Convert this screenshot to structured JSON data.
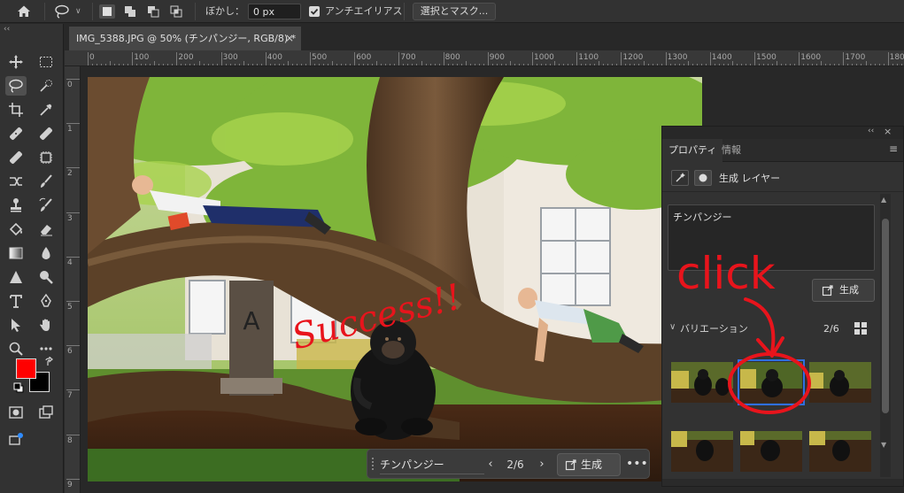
{
  "options_bar": {
    "feather_label": "ぼかし：",
    "feather_value": "0 px",
    "antialias_label": "アンチエイリアス",
    "antialias_checked": true,
    "select_mask_label": "選択とマスク..."
  },
  "toolbar": {
    "collapse_glyph": "‹‹",
    "foreground_color": "#ff0000",
    "background_color": "#000000"
  },
  "document": {
    "tab_title": "IMG_5388.JPG @ 50% (チンパンジー, RGB/8) *",
    "tab_close": "×"
  },
  "rulers": {
    "horizontal": [
      "0",
      "100",
      "200",
      "300",
      "400",
      "500",
      "600",
      "700",
      "800",
      "900",
      "1000",
      "1100",
      "1200",
      "1300",
      "1400",
      "1500",
      "1600",
      "1700",
      "1800"
    ],
    "vertical": [
      "0",
      "1",
      "2",
      "3",
      "4",
      "5",
      "6",
      "7",
      "8",
      "9"
    ]
  },
  "canvas_annotations": {
    "success_text": "Success!!",
    "click_text": "click"
  },
  "taskbar": {
    "prompt": "チンパンジー",
    "prev": "‹",
    "count": "2/6",
    "next": "›",
    "generate_label": "生成",
    "more": "•••"
  },
  "panel": {
    "collapse": "‹‹",
    "close": "×",
    "tabs": [
      "プロパティ",
      "情報"
    ],
    "menu": "≡",
    "layer_title": "生成 レイヤー",
    "prompt_text": "チンパンジー",
    "generate_label": "生成",
    "variations_label": "バリエーション",
    "variations_count": "2/6",
    "variations_chevron": "∨",
    "scroll_up": "▲",
    "scroll_down": "▼"
  },
  "colors": {
    "annotation_red": "#e8141c",
    "selection_blue": "#2f6fe0"
  }
}
